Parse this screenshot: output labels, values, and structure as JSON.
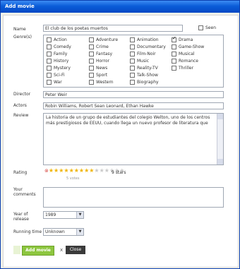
{
  "window": {
    "title": "Add movie"
  },
  "form": {
    "name_label": "Name",
    "name_value": "El club de los poetas muertos",
    "seen_label": "Seen",
    "genres_label": "Genre(s)",
    "director_label": "Director",
    "director_value": "Peter Weir",
    "actors_label": "Actors",
    "actors_value": "Robin Williams, Robert Sean Leonard, Ethan Hawke",
    "review_label": "Review",
    "review_value": "La historia de un grupo de estudiantes del colegio Welton, uno de los centros más prestigiosos de EEUU, cuando llega un nuevo profesor de literatura que",
    "rating_label": "Rating",
    "rating_text": "9 stars",
    "rating_sub": "5 votes",
    "rating_value": 9,
    "rating_max": 15,
    "comments_label": "Your comments",
    "year_label": "Year of release",
    "year_value": "1989",
    "runtime_label": "Running time",
    "runtime_value": "Unknown",
    "add_button": "Add movie",
    "close_button": "Close"
  },
  "genres": [
    {
      "label": "Action",
      "checked": false
    },
    {
      "label": "Comedy",
      "checked": false
    },
    {
      "label": "Family",
      "checked": false
    },
    {
      "label": "History",
      "checked": false
    },
    {
      "label": "Mystery",
      "checked": false
    },
    {
      "label": "Sci-Fi",
      "checked": false
    },
    {
      "label": "War",
      "checked": false
    },
    {
      "label": "Adventure",
      "checked": false
    },
    {
      "label": "Crime",
      "checked": false
    },
    {
      "label": "Fantasy",
      "checked": false
    },
    {
      "label": "Horror",
      "checked": false
    },
    {
      "label": "News",
      "checked": false
    },
    {
      "label": "Sport",
      "checked": false
    },
    {
      "label": "Western",
      "checked": false
    },
    {
      "label": "Animation",
      "checked": false
    },
    {
      "label": "Documentary",
      "checked": false
    },
    {
      "label": "Film-Noir",
      "checked": false
    },
    {
      "label": "Music",
      "checked": false
    },
    {
      "label": "Reality-TV",
      "checked": false
    },
    {
      "label": "Talk-Show",
      "checked": false
    },
    {
      "label": "Biography",
      "checked": false
    },
    {
      "label": "Drama",
      "checked": true
    },
    {
      "label": "Game-Show",
      "checked": false
    },
    {
      "label": "Musical",
      "checked": false
    },
    {
      "label": "Romance",
      "checked": false
    },
    {
      "label": "Thriller",
      "checked": false
    }
  ]
}
